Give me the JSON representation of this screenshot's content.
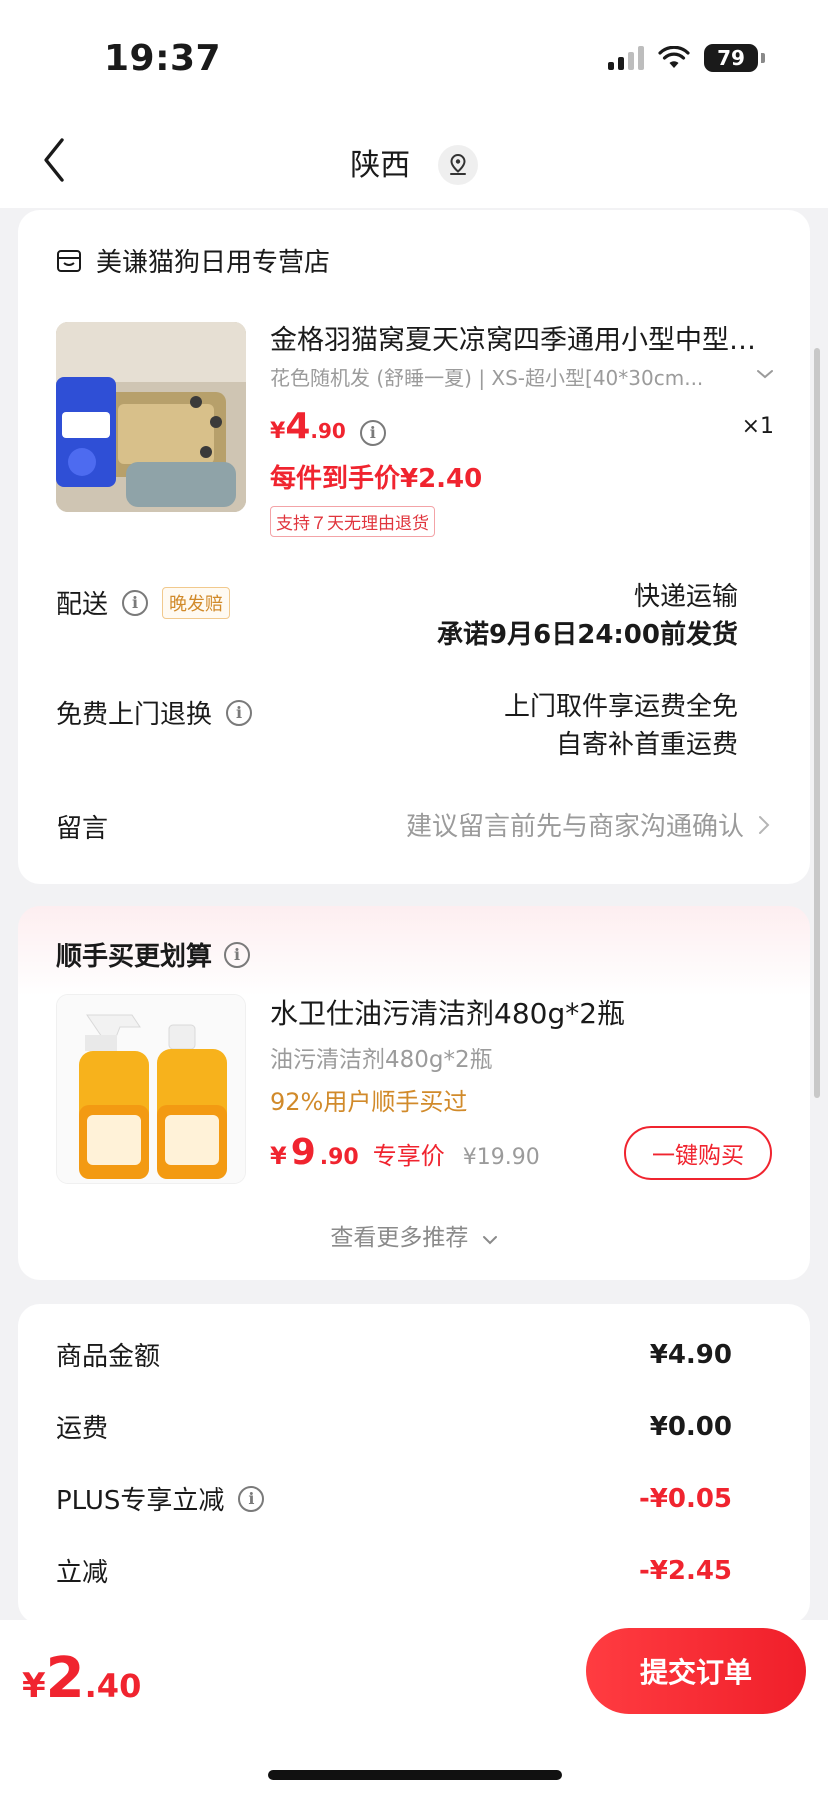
{
  "status_bar": {
    "time": "19:37",
    "battery": "79"
  },
  "header": {
    "location": "陕西"
  },
  "order": {
    "shop_name": "美谦猫狗日用专营店",
    "product": {
      "title": "金格羽猫窝夏天凉窝四季通用小型中型…",
      "spec": "花色随机发 (舒睡一夏) | XS-超小型[40*30cm...",
      "price_currency": "¥",
      "price_int": "4",
      "price_dec": ".90",
      "quantity": "×1",
      "unit_price": "每件到手价¥2.40",
      "return_tag": "支持７天无理由退货"
    },
    "delivery": {
      "label": "配送",
      "tag": "晚发赔",
      "method": "快递运输",
      "promise": "承诺9月6日24:00前发货"
    },
    "free_return": {
      "label": "免费上门退换",
      "line1": "上门取件享运费全免",
      "line2": "自寄补首重运费"
    },
    "memo": {
      "label": "留言",
      "placeholder": "建议留言前先与商家沟通确认"
    }
  },
  "addon": {
    "title": "顺手买更划算",
    "product": {
      "title": "水卫仕油污清洁剂480g*2瓶",
      "spec": "油污清洁剂480g*2瓶",
      "buyers": "92%用户顺手买过",
      "price_currency": "¥",
      "price_int": "9",
      "price_dec": ".90",
      "price_label": "专享价",
      "original_price": "¥19.90",
      "buy_button": "一键购买"
    },
    "more": "查看更多推荐"
  },
  "summary": {
    "rows": [
      {
        "label": "商品金额",
        "value": "¥4.90"
      },
      {
        "label": "运费",
        "value": "¥0.00"
      },
      {
        "label": "PLUS专享立减",
        "value": "-¥0.05"
      },
      {
        "label": "立减",
        "value": "-¥2.45"
      }
    ]
  },
  "footer": {
    "total_currency": "¥",
    "total_int": "2",
    "total_dec": ".40",
    "submit": "提交订单"
  },
  "colors": {
    "accent_red": "#f0242f",
    "tag_orange": "#d18a2a",
    "page_bg": "#f2f2f4"
  }
}
